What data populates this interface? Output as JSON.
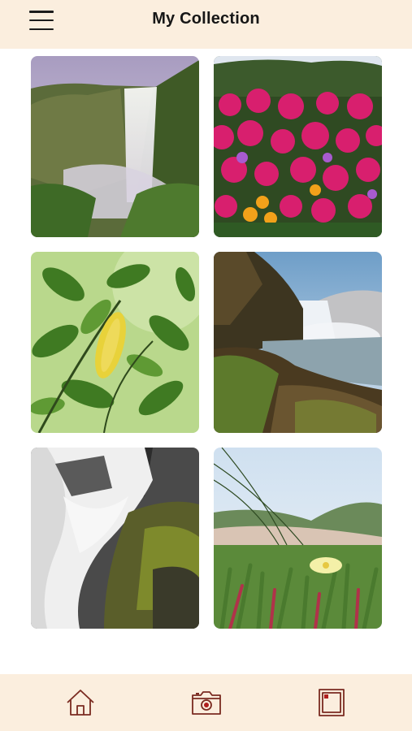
{
  "header": {
    "title": "My Collection",
    "menu_icon": "hamburger-menu-icon",
    "background": "#fbeede"
  },
  "gallery": {
    "photos": [
      {
        "subject": "waterfall-cliff"
      },
      {
        "subject": "pink-flowers"
      },
      {
        "subject": "green-leaves"
      },
      {
        "subject": "waterfall-coast"
      },
      {
        "subject": "mossy-waterfall"
      },
      {
        "subject": "succulent-dunes"
      }
    ]
  },
  "bottom_nav": {
    "items": [
      {
        "icon": "home-icon"
      },
      {
        "icon": "camera-icon"
      },
      {
        "icon": "gallery-icon"
      }
    ],
    "icon_color": "#7a2a20",
    "background": "#fbeede"
  }
}
